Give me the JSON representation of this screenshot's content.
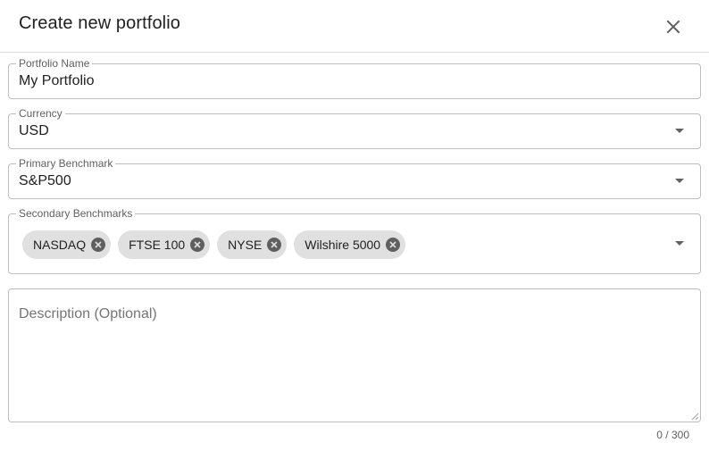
{
  "dialog": {
    "title": "Create new portfolio",
    "close_icon": "close-icon"
  },
  "fields": {
    "portfolio_name": {
      "label": "Portfolio Name",
      "value": "My Portfolio"
    },
    "currency": {
      "label": "Currency",
      "value": "USD",
      "icon": "chevron-down-icon"
    },
    "primary_benchmark": {
      "label": "Primary Benchmark",
      "value": "S&P500",
      "icon": "chevron-down-icon"
    },
    "secondary_benchmarks": {
      "label": "Secondary Benchmarks",
      "chips": [
        {
          "label": "NASDAQ",
          "icon": "cancel-icon"
        },
        {
          "label": "FTSE 100",
          "icon": "cancel-icon"
        },
        {
          "label": "NYSE",
          "icon": "cancel-icon"
        },
        {
          "label": "Wilshire 5000",
          "icon": "cancel-icon"
        }
      ],
      "icon": "chevron-down-icon"
    },
    "description": {
      "placeholder": "Description (Optional)",
      "counter": "0 / 300"
    }
  }
}
